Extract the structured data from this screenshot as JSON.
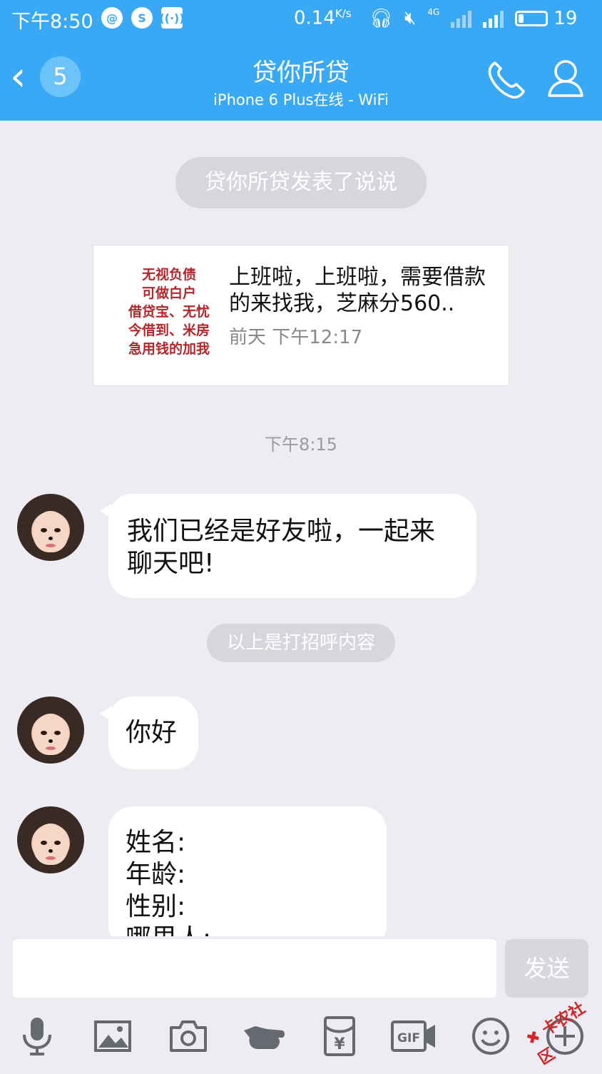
{
  "status_bar": {
    "time": "下午8:50",
    "left_icons": [
      "netease-icon",
      "weibo-icon",
      "wireless-icon"
    ],
    "net_speed": "0.14",
    "net_unit": "K/s",
    "network": "4G",
    "battery": "19",
    "battery_level": 0.19
  },
  "header": {
    "back_badge": "5",
    "title": "贷你所贷",
    "subtitle": "iPhone 6 Plus在线 - WiFi"
  },
  "system_notice": "贷你所贷发表了说说",
  "shared_post": {
    "thumbnail_lines": [
      "无视负债",
      "可做白户",
      "借贷宝、无忧",
      "今借到、米房",
      "急用钱的加我"
    ],
    "text": "上班啦，上班啦，需要借款的来找我，芝麻分560..",
    "time": "前天 下午12:17"
  },
  "timestamp": "下午8:15",
  "messages": [
    {
      "text": "我们已经是好友啦，一起来聊天吧!"
    },
    {
      "text": "你好"
    },
    {
      "lines": [
        "姓名:",
        "年龄:",
        "性别:",
        "哪里人:"
      ]
    }
  ],
  "greeting_divider": "以上是打招呼内容",
  "input": {
    "value": "",
    "placeholder": ""
  },
  "send_label": "发送",
  "watermark": "卡农社区",
  "colors": {
    "header_blue": "#3aa9f5",
    "chat_bg": "#ececf2",
    "icon_gray": "#666a70"
  },
  "toolbar_icons": [
    "mic-icon",
    "image-icon",
    "camera-icon",
    "poke-icon",
    "red-packet-icon",
    "gif-icon",
    "emoji-icon",
    "plus-icon"
  ]
}
